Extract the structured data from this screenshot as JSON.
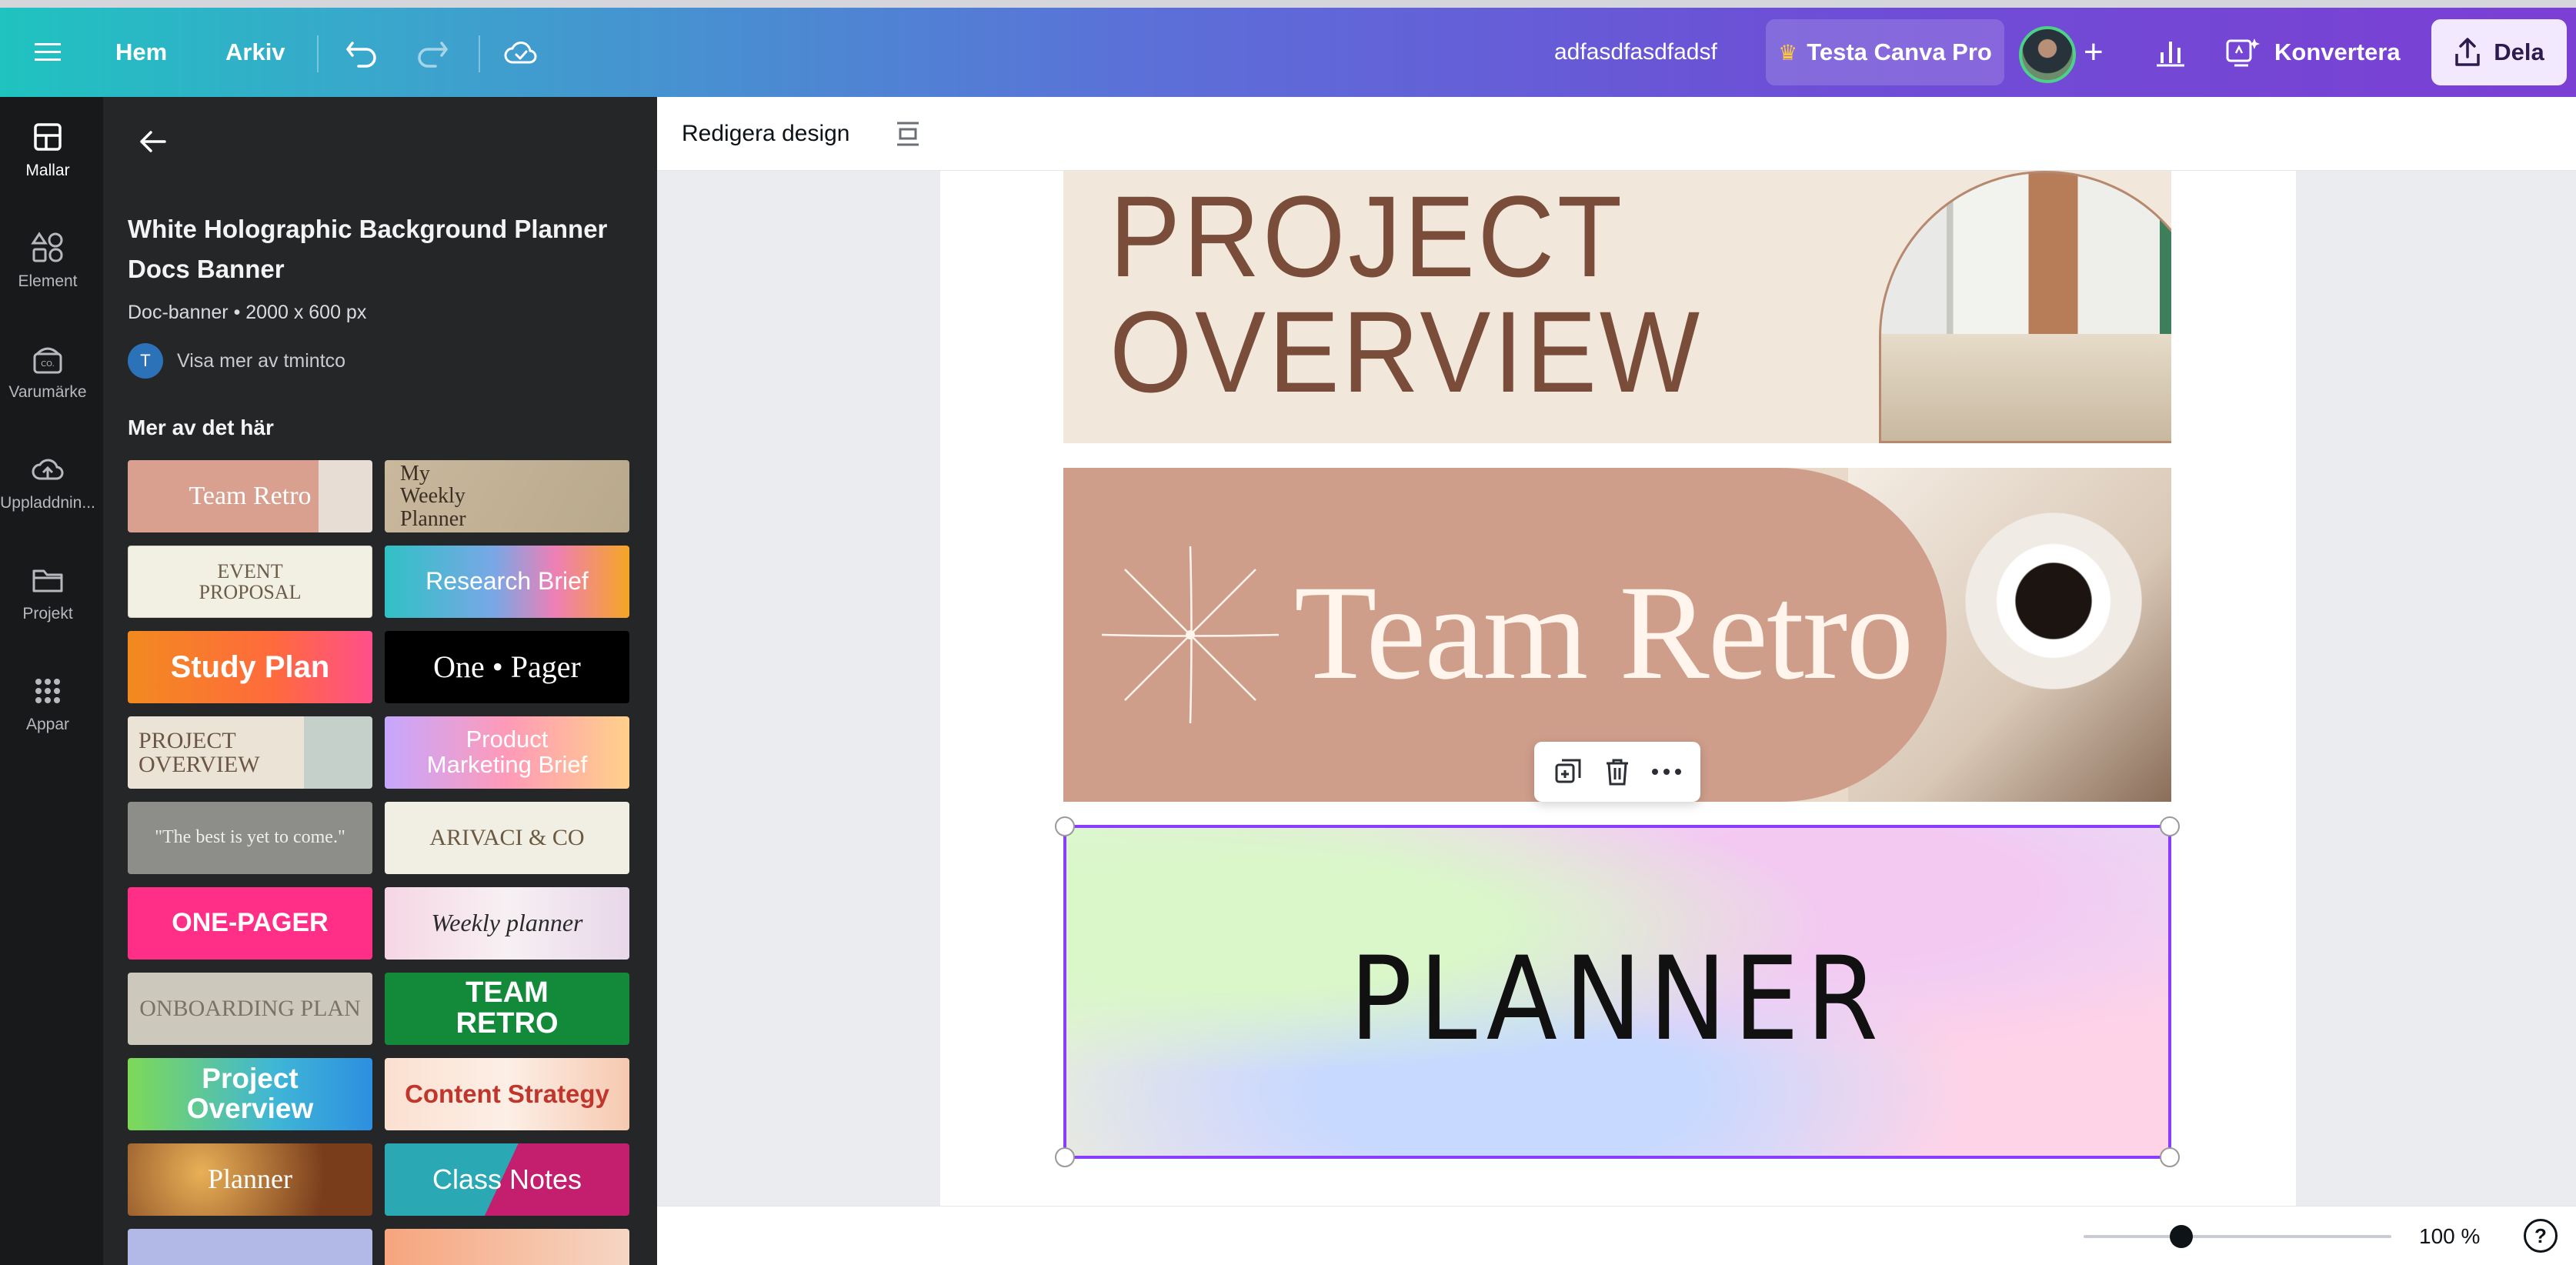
{
  "topbar": {
    "home": "Hem",
    "file": "Arkiv",
    "doc_title": "adfasdfasdfadsf",
    "pro": "Testa Canva Pro",
    "convert": "Konvertera",
    "share": "Dela",
    "icons": [
      "menu-icon",
      "undo-icon",
      "redo-icon",
      "cloud-sync-icon",
      "crown-icon",
      "plus-icon",
      "stats-icon",
      "magic-convert-icon",
      "upload-share-icon"
    ]
  },
  "rail": {
    "items": [
      {
        "label": "Mallar",
        "icon": "templates-icon"
      },
      {
        "label": "Element",
        "icon": "elements-icon"
      },
      {
        "label": "Varumärke",
        "icon": "brand-icon"
      },
      {
        "label": "Uppladdnin...",
        "icon": "upload-icon"
      },
      {
        "label": "Projekt",
        "icon": "folder-icon"
      },
      {
        "label": "Appar",
        "icon": "apps-icon"
      }
    ]
  },
  "panel": {
    "title": "White Holographic Background Planner Docs Banner",
    "meta": "Doc-banner • 2000 x 600 px",
    "author_initial": "T",
    "author_link": "Visa mer av tmintco",
    "more_heading": "Mer av det här",
    "templates": [
      "Team Retro",
      "My Weekly Planner",
      "EVENT PROPOSAL",
      "Research Brief",
      "Study Plan",
      "One • Pager",
      "PROJECT OVERVIEW",
      "Product Marketing Brief",
      "\"The best is yet to come.\"",
      "ARIVACI & CO",
      "ONE-PAGER",
      "Weekly planner",
      "ONBOARDING PLAN",
      "TEAM RETRO",
      "Project Overview",
      "Content Strategy",
      "Planner",
      "Class Notes",
      "",
      ""
    ]
  },
  "editor": {
    "edit_label": "Redigera design",
    "banners": {
      "b1_line1": "PROJECT",
      "b1_line2": "OVERVIEW",
      "b2": "Team Retro",
      "b3": "PLANNER"
    }
  },
  "status": {
    "zoom": "100 %",
    "help": "?",
    "zoom_percent": 100
  }
}
